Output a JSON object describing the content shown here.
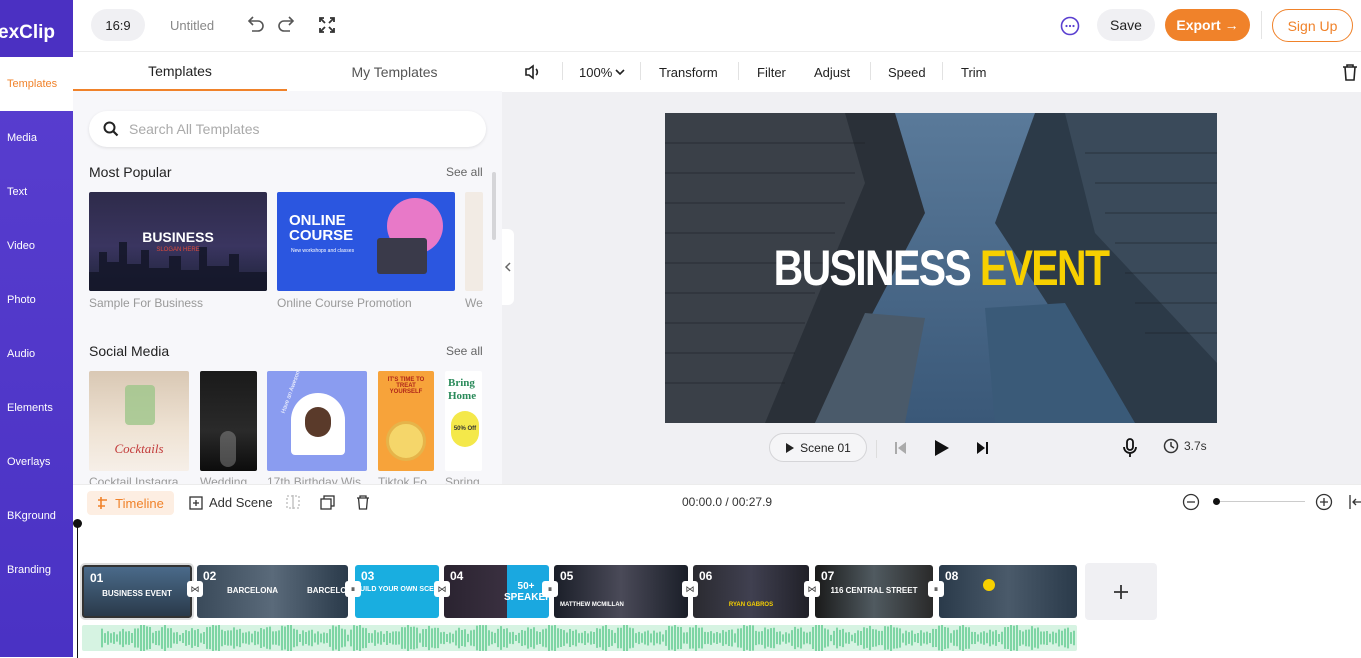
{
  "app": {
    "logo_text": "exClip"
  },
  "header": {
    "ratio": "16:9",
    "title": "Untitled",
    "save_label": "Save",
    "export_label": "Export →",
    "signup_label": "Sign Up"
  },
  "rail": {
    "items": [
      {
        "label": "Templates"
      },
      {
        "label": "Media"
      },
      {
        "label": "Text"
      },
      {
        "label": "Video"
      },
      {
        "label": "Photo"
      },
      {
        "label": "Audio"
      },
      {
        "label": "Elements"
      },
      {
        "label": "Overlays"
      },
      {
        "label": "BKground"
      },
      {
        "label": "Branding"
      }
    ]
  },
  "panel": {
    "tabs": [
      {
        "label": "Templates"
      },
      {
        "label": "My Templates"
      }
    ],
    "search_placeholder": "Search All Templates",
    "sections": [
      {
        "title": "Most Popular",
        "see_all": "See all",
        "items": [
          {
            "caption": "Sample For Business",
            "thumb_title": "BUSINESS",
            "thumb_sub": "SLOGAN HERE"
          },
          {
            "caption": "Online Course Promotion",
            "thumb_title": "ONLINE COURSE",
            "thumb_sub": "New workshops and classes"
          },
          {
            "caption": "We"
          }
        ]
      },
      {
        "title": "Social Media",
        "see_all": "See all",
        "items": [
          {
            "caption": "Cocktail Instagra...",
            "thumb_title": "Cocktails"
          },
          {
            "caption": "Wedding ..."
          },
          {
            "caption": "17th Birthday Wis...",
            "thumb_title": "Have an Awesome Party"
          },
          {
            "caption": "Tiktok Fo...",
            "thumb_title": "IT'S TIME TO TREAT YOURSELF"
          },
          {
            "caption": "Spring I...",
            "thumb_title": "Bring Home",
            "thumb_badge": "50% Off"
          }
        ]
      }
    ]
  },
  "toolbar": {
    "zoom": "100%",
    "items": [
      "Transform",
      "Filter",
      "Adjust",
      "Speed",
      "Trim"
    ]
  },
  "preview": {
    "title_white": "BUSINESS",
    "title_yellow": "EVENT",
    "scene_label": "Scene 01",
    "duration": "3.7s"
  },
  "timeline": {
    "tab_label": "Timeline",
    "add_scene": "Add Scene",
    "time": "00:00.0 / 00:27.9",
    "clips": [
      {
        "num": "01",
        "text": "BUSINESS EVENT"
      },
      {
        "num": "02",
        "text": "BARCELONA"
      },
      {
        "num": "03",
        "text": "BUILD YOUR OWN SCENE"
      },
      {
        "num": "04",
        "text": "50+ SPEAKERS"
      },
      {
        "num": "05",
        "text": "MATTHEW MCMILLAN"
      },
      {
        "num": "06",
        "text": "RYAN GABROS"
      },
      {
        "num": "07",
        "text": "116 CENTRAL STREET"
      },
      {
        "num": "08",
        "text": ""
      }
    ]
  },
  "colors": {
    "accent": "#f0822a",
    "brand": "#4b30c2",
    "wave": "#58c88a"
  }
}
